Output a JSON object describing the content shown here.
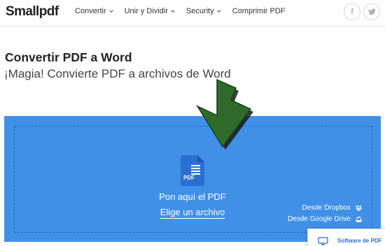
{
  "header": {
    "logo": "Smallpdf",
    "nav": [
      {
        "label": "Convertir",
        "dropdown": true
      },
      {
        "label": "Unir y Dividir",
        "dropdown": true
      },
      {
        "label": "Security",
        "dropdown": true
      },
      {
        "label": "Comprimir PDF",
        "dropdown": false
      }
    ],
    "social": {
      "facebook": "f",
      "twitter": "twitter-icon"
    }
  },
  "page": {
    "title": "Convertir PDF a Word",
    "subtitle": "¡Magia! Convierte PDF a archivos de Word"
  },
  "dropzone": {
    "icon_label": "PDF",
    "drop_text": "Pon aquí el PDF",
    "choose_link": "Elige un archivo",
    "dropbox_label": "Desde Dropbox",
    "gdrive_label": "Desde Google Drive",
    "bg_color": "#4190e8"
  },
  "promo": {
    "label": "Software de PDF"
  },
  "colors": {
    "accent": "#4190e8",
    "arrow": "#2e6b2a",
    "link": "#2e6dc9"
  }
}
